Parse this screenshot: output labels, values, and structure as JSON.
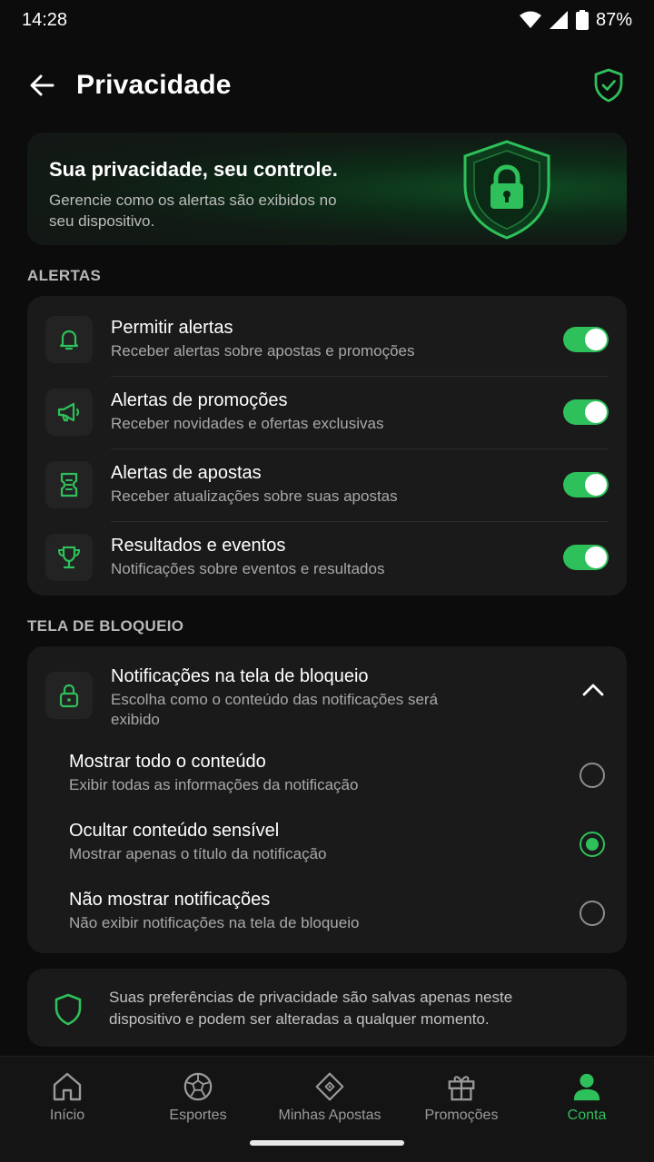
{
  "status": {
    "time": "14:28",
    "battery": "87%"
  },
  "header": {
    "title": "Privacidade"
  },
  "hero": {
    "title": "Sua privacidade, seu controle.",
    "description": "Gerencie como os alertas são exibidos no seu dispositivo."
  },
  "alerts": {
    "section_label": "ALERTAS",
    "items": [
      {
        "title": "Permitir alertas",
        "subtitle": "Receber alertas sobre apostas e promoções",
        "enabled": true,
        "icon": "bell-icon"
      },
      {
        "title": "Alertas de promoções",
        "subtitle": "Receber novidades e ofertas exclusivas",
        "enabled": true,
        "icon": "megaphone-icon"
      },
      {
        "title": "Alertas de apostas",
        "subtitle": "Receber atualizações sobre suas apostas",
        "enabled": true,
        "icon": "ticket-icon"
      },
      {
        "title": "Resultados e eventos",
        "subtitle": "Notificações sobre eventos e resultados",
        "enabled": true,
        "icon": "trophy-icon"
      }
    ]
  },
  "lockscreen": {
    "section_label": "TELA DE BLOQUEIO",
    "title": "Notificações na tela de bloqueio",
    "subtitle": "Escolha como o conteúdo das notificações será exibido",
    "options": [
      {
        "title": "Mostrar todo o conteúdo",
        "subtitle": "Exibir todas as informações da notificação",
        "selected": false
      },
      {
        "title": "Ocultar conteúdo sensível",
        "subtitle": "Mostrar apenas o título da notificação",
        "selected": true
      },
      {
        "title": "Não mostrar notificações",
        "subtitle": "Não exibir notificações na tela de bloqueio",
        "selected": false
      }
    ]
  },
  "info": {
    "text": "Suas preferências de privacidade são salvas apenas neste dispositivo e podem ser alteradas a qualquer momento."
  },
  "nav": {
    "items": [
      {
        "label": "Início",
        "icon": "home-icon",
        "active": false
      },
      {
        "label": "Esportes",
        "icon": "soccer-ball-icon",
        "active": false
      },
      {
        "label": "Minhas Apostas",
        "icon": "bet-ticket-icon",
        "active": false
      },
      {
        "label": "Promoções",
        "icon": "gift-icon",
        "active": false
      },
      {
        "label": "Conta",
        "icon": "user-icon",
        "active": true
      }
    ]
  },
  "colors": {
    "accent": "#2ec05a",
    "background": "#0c0c0c",
    "card": "#1a1a1a"
  }
}
